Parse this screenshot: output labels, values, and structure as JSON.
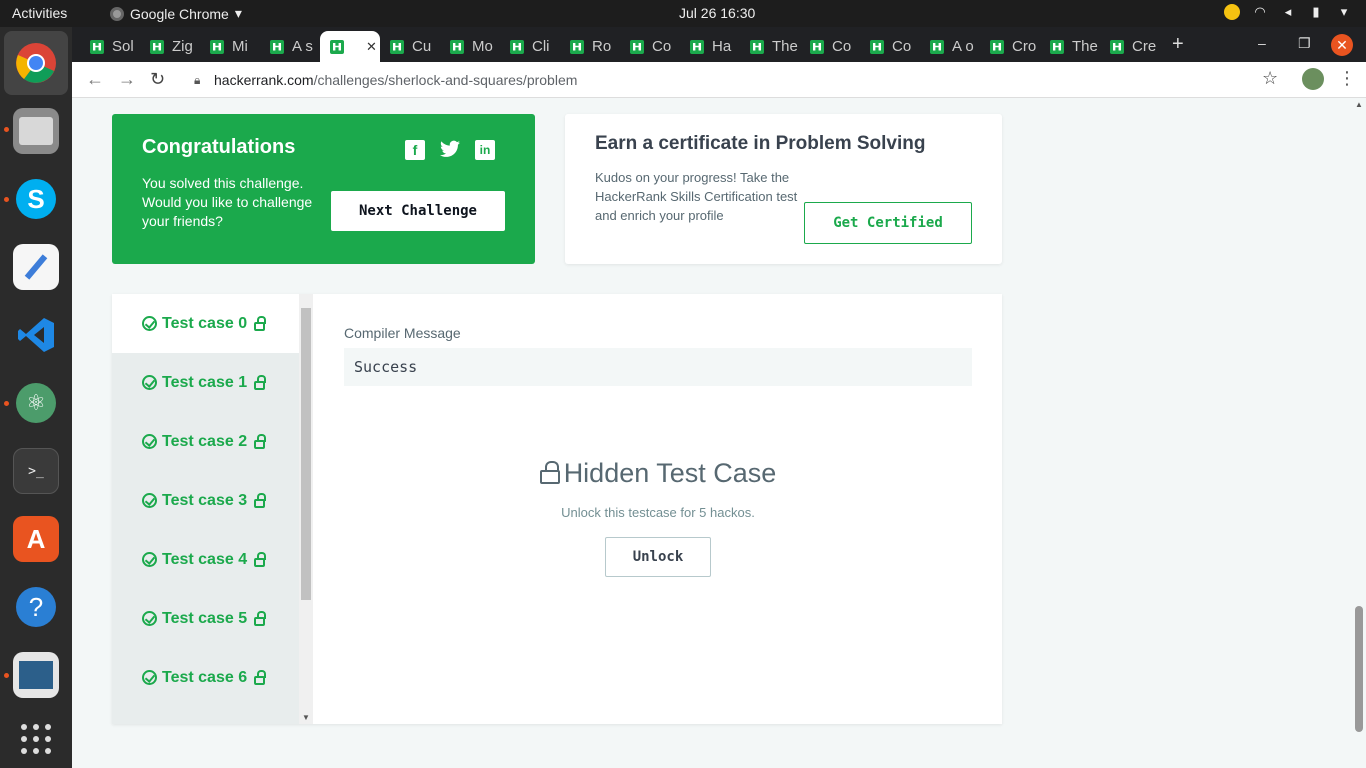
{
  "system_bar": {
    "activities": "Activities",
    "app_name": "Google Chrome",
    "app_caret": "▾",
    "datetime": "Jul 26  16:30"
  },
  "browser": {
    "tabs": [
      {
        "title": "Sol"
      },
      {
        "title": "Zig"
      },
      {
        "title": "Mi"
      },
      {
        "title": "A s"
      },
      {
        "title": "",
        "active": true
      },
      {
        "title": "Cu"
      },
      {
        "title": "Mo"
      },
      {
        "title": "Cli"
      },
      {
        "title": "Ro"
      },
      {
        "title": "Co"
      },
      {
        "title": "Ha"
      },
      {
        "title": "The"
      },
      {
        "title": "Co"
      },
      {
        "title": "Co"
      },
      {
        "title": "A o"
      },
      {
        "title": "Cro"
      },
      {
        "title": "The"
      },
      {
        "title": "Cre"
      }
    ],
    "new_tab": "+",
    "url_domain": "hackerrank.com",
    "url_path": "/challenges/sherlock-and-squares/problem"
  },
  "congrats": {
    "title": "Congratulations",
    "message": "You solved this challenge. Would you like to challenge your friends?",
    "next_button": "Next Challenge",
    "social": {
      "facebook": "f",
      "twitter": "t",
      "linkedin": "in"
    }
  },
  "certificate": {
    "title": "Earn a certificate in Problem Solving",
    "description": "Kudos on your progress! Take the HackerRank Skills Certification test and enrich your profile",
    "button": "Get Certified"
  },
  "test_cases": [
    {
      "label": "Test case 0",
      "active": true
    },
    {
      "label": "Test case 1"
    },
    {
      "label": "Test case 2"
    },
    {
      "label": "Test case 3"
    },
    {
      "label": "Test case 4"
    },
    {
      "label": "Test case 5"
    },
    {
      "label": "Test case 6"
    }
  ],
  "detail": {
    "compiler_label": "Compiler Message",
    "compiler_message": "Success",
    "hidden_title": "Hidden Test Case",
    "hidden_subtitle": "Unlock this testcase for 5 hackos.",
    "unlock_button": "Unlock"
  },
  "colors": {
    "accent_green": "#1ba94c",
    "ubuntu_orange": "#e95420"
  }
}
